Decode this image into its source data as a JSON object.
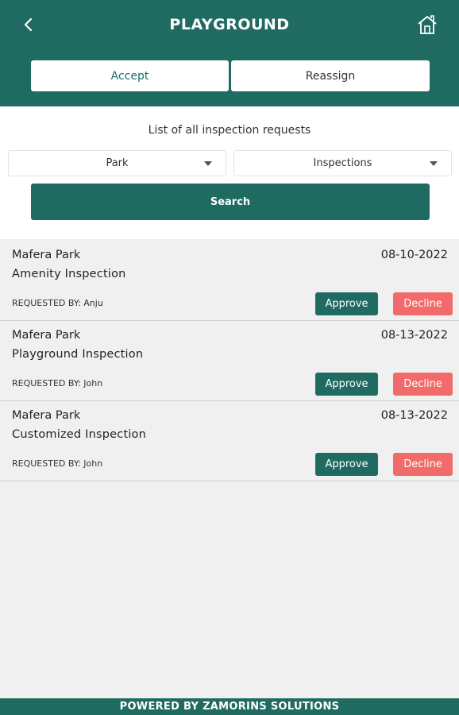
{
  "header": {
    "title": "PLAYGROUND",
    "back_icon": "chevron-left-icon",
    "home_icon": "home-icon",
    "color": "#1f6b62"
  },
  "tabs": [
    {
      "label": "Accept",
      "active": true
    },
    {
      "label": "Reassign",
      "active": false
    }
  ],
  "filters": {
    "caption": "List of all inspection requests",
    "park_select": "Park",
    "type_select": "Inspections",
    "search_label": "Search"
  },
  "requests": [
    {
      "park": "Mafera Park",
      "date": "08-10-2022",
      "type": "Amenity Inspection",
      "requested_by": "REQUESTED BY: Anju",
      "approve": "Approve",
      "decline": "Decline"
    },
    {
      "park": "Mafera Park",
      "date": "08-13-2022",
      "type": "Playground Inspection",
      "requested_by": "REQUESTED BY: John",
      "approve": "Approve",
      "decline": "Decline"
    },
    {
      "park": "Mafera Park",
      "date": "08-13-2022",
      "type": "Customized Inspection",
      "requested_by": "REQUESTED BY: John",
      "approve": "Approve",
      "decline": "Decline"
    }
  ],
  "footer": {
    "text": "POWERED BY ZAMORINS SOLUTIONS"
  },
  "colors": {
    "primary": "#1f6b62",
    "decline": "#f26b6b",
    "background": "#f0f0f0"
  }
}
